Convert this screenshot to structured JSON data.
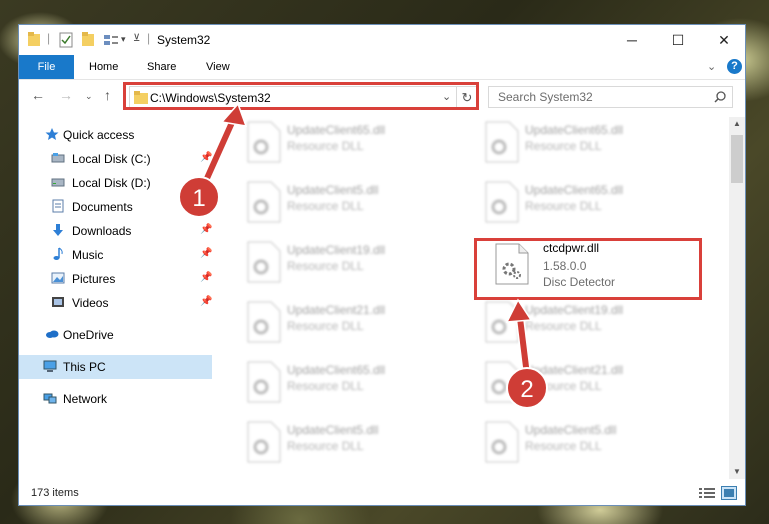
{
  "window": {
    "title": "System32",
    "controls": {
      "minimize": "─",
      "maximize": "☐",
      "close": "✕"
    }
  },
  "ribbon": {
    "tabs": [
      "File",
      "Home",
      "Share",
      "View"
    ],
    "collapse_icon": "chevron-down-icon",
    "help": "?"
  },
  "navigation": {
    "address": "C:\\Windows\\System32",
    "search_placeholder": "Search System32"
  },
  "sidebar": {
    "items": [
      {
        "label": "Quick access",
        "icon": "star-icon",
        "pinned": false
      },
      {
        "label": "Local Disk (C:)",
        "icon": "drive-icon",
        "pinned": true
      },
      {
        "label": "Local Disk (D:)",
        "icon": "drive-icon",
        "pinned": false
      },
      {
        "label": "Documents",
        "icon": "document-icon",
        "pinned": true
      },
      {
        "label": "Downloads",
        "icon": "download-icon",
        "pinned": true
      },
      {
        "label": "Music",
        "icon": "music-icon",
        "pinned": true
      },
      {
        "label": "Pictures",
        "icon": "pictures-icon",
        "pinned": true
      },
      {
        "label": "Videos",
        "icon": "videos-icon",
        "pinned": true
      },
      {
        "label": "OneDrive",
        "icon": "cloud-icon",
        "pinned": false
      },
      {
        "label": "This PC",
        "icon": "computer-icon",
        "pinned": false,
        "selected": true
      },
      {
        "label": "Network",
        "icon": "network-icon",
        "pinned": false
      }
    ]
  },
  "files": {
    "left": [
      {
        "name": "UpdateClient65.dll",
        "type": "Resource DLL"
      },
      {
        "name": "UpdateClient5.dll",
        "type": "Resource DLL"
      },
      {
        "name": "UpdateClient19.dll",
        "type": "Resource DLL"
      },
      {
        "name": "UpdateClient21.dll",
        "type": "Resource DLL"
      },
      {
        "name": "UpdateClient65.dll",
        "type": "Resource DLL"
      },
      {
        "name": "UpdateClient5.dll",
        "type": "Resource DLL"
      }
    ],
    "right": [
      {
        "name": "UpdateClient65.dll",
        "type": "Resource DLL"
      },
      {
        "name": "UpdateClient65.dll",
        "type": "Resource DLL"
      },
      {
        "name": "ctcdpwr.dll",
        "version": "1.58.0.0",
        "type": "Disc Detector",
        "highlighted": true
      },
      {
        "name": "UpdateClient19.dll",
        "type": "Resource DLL"
      },
      {
        "name": "UpdateClient21.dll",
        "type": "Resource DLL"
      },
      {
        "name": "UpdateClient5.dll",
        "type": "Resource DLL"
      }
    ]
  },
  "status": {
    "items_count": "173 items"
  },
  "annotations": {
    "step1": "1",
    "step2": "2",
    "color": "#cf3d36"
  }
}
